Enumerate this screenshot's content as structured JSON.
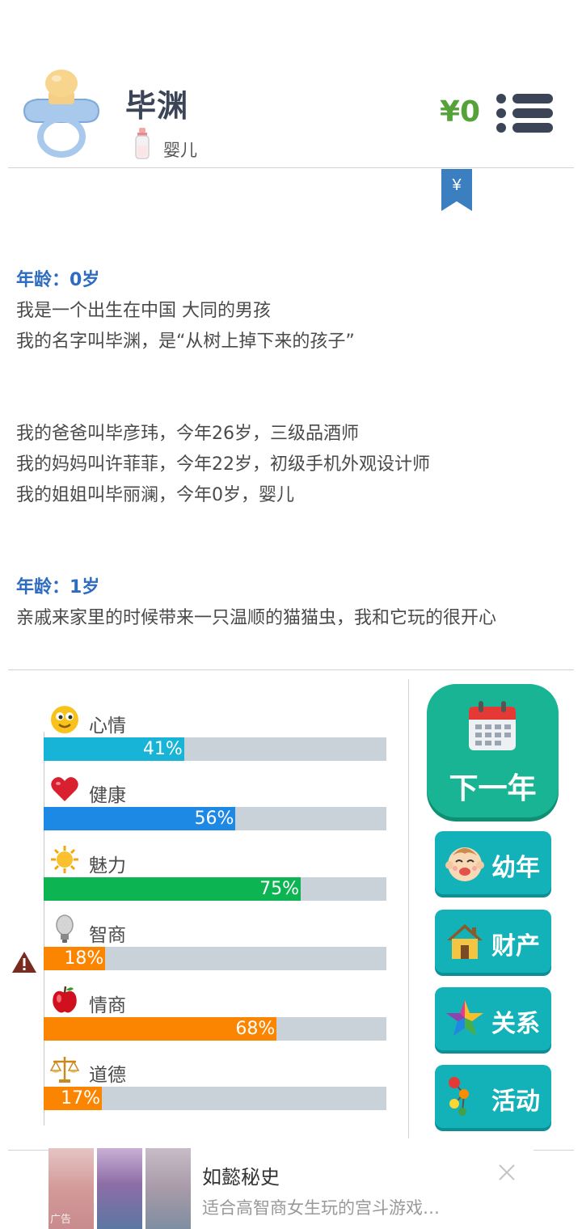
{
  "header": {
    "name": "毕渊",
    "stage": "婴儿",
    "money": "¥0",
    "bookmark_symbol": "¥"
  },
  "story": {
    "entries": [
      {
        "age": "年龄：0岁",
        "lines": [
          "我是一个出生在中国 大同的男孩",
          "我的名字叫毕渊，是“从树上掉下来的孩子”"
        ]
      },
      {
        "lines": [
          "我的爸爸叫毕彦玮，今年26岁，三级品酒师",
          "我的妈妈叫许菲菲，今年22岁，初级手机外观设计师",
          "我的姐姐叫毕丽澜，今年0岁，婴儿"
        ]
      },
      {
        "age": "年龄：1岁",
        "lines": [
          "亲戚来家里的时候带来一只温顺的猫猫虫，我和它玩的很开心"
        ]
      }
    ]
  },
  "stats": [
    {
      "label": "心情",
      "value": 41,
      "text": "41%",
      "color": "#18b4d8",
      "icon": "smiley-icon"
    },
    {
      "label": "健康",
      "value": 56,
      "text": "56%",
      "color": "#1e88e5",
      "icon": "heart-icon"
    },
    {
      "label": "魅力",
      "value": 75,
      "text": "75%",
      "color": "#0cb552",
      "icon": "sun-icon"
    },
    {
      "label": "智商",
      "value": 18,
      "text": "18%",
      "color": "#fb8500",
      "icon": "lightbulb-icon"
    },
    {
      "label": "情商",
      "value": 68,
      "text": "68%",
      "color": "#fb8500",
      "icon": "apple-icon"
    },
    {
      "label": "道德",
      "value": 17,
      "text": "17%",
      "color": "#fb8500",
      "icon": "scale-icon"
    }
  ],
  "buttons": {
    "next_year": "下一年",
    "childhood": "幼年",
    "property": "财产",
    "relations": "关系",
    "activities": "活动"
  },
  "ad": {
    "title": "如懿秘史",
    "desc": "适合高智商女生玩的宫斗游戏…",
    "tag": "广告"
  }
}
